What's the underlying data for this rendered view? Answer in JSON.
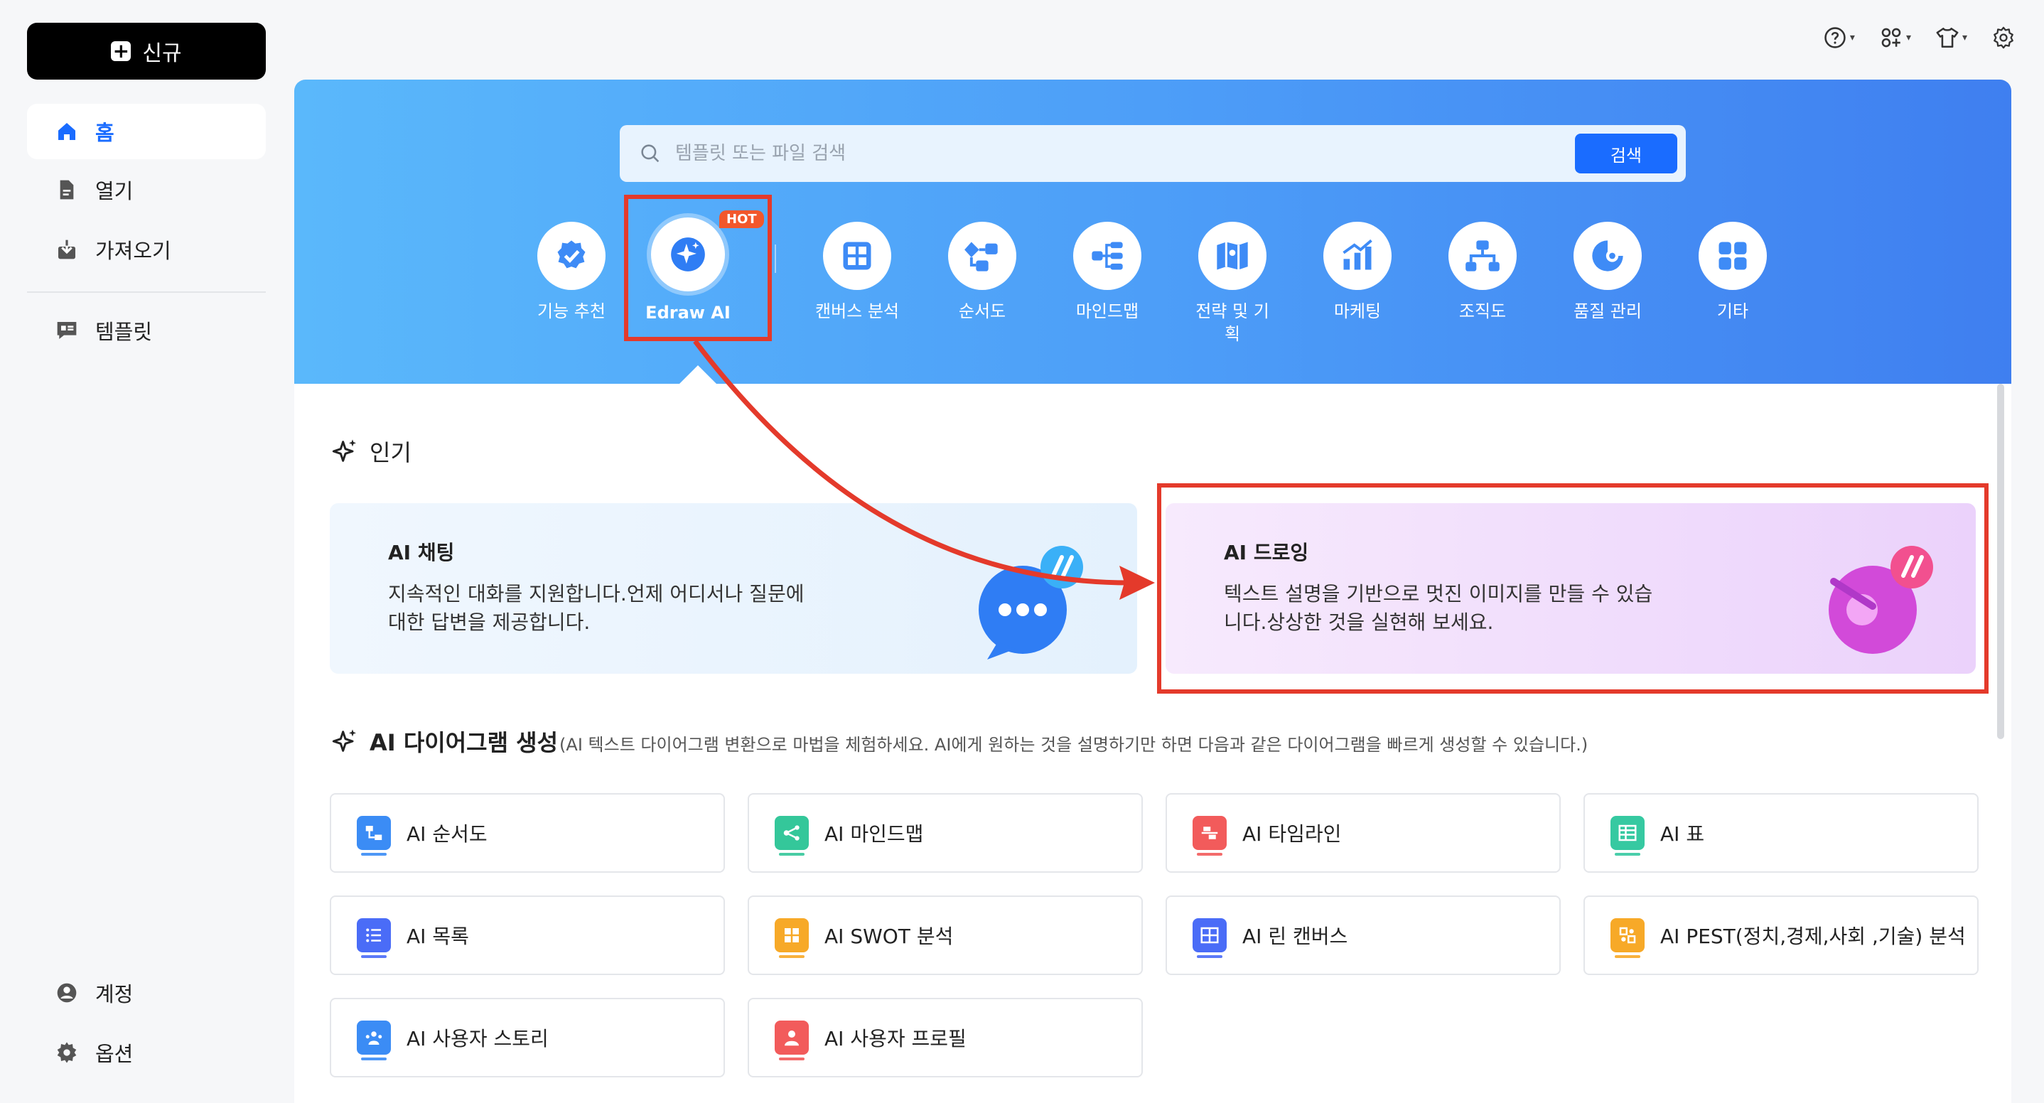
{
  "sidebar": {
    "new_button": "신규",
    "items": [
      {
        "label": "홈",
        "icon": "home-icon"
      },
      {
        "label": "열기",
        "icon": "file-icon"
      },
      {
        "label": "가져오기",
        "icon": "import-icon"
      },
      {
        "label": "템플릿",
        "icon": "template-icon"
      }
    ],
    "bottom": [
      {
        "label": "계정",
        "icon": "account-icon"
      },
      {
        "label": "옵션",
        "icon": "settings-icon"
      }
    ]
  },
  "top_icons": [
    "help-icon",
    "apps-icon",
    "shirt-icon",
    "gear-icon"
  ],
  "search": {
    "placeholder": "템플릿 또는 파일 검색",
    "button": "검색"
  },
  "categories": [
    {
      "label": "기능 추천",
      "icon": "badge-check-icon"
    },
    {
      "label": "Edraw AI",
      "icon": "ai-sparkle-icon",
      "badge": "HOT"
    },
    {
      "label": "캔버스 분석",
      "icon": "canvas-grid-icon"
    },
    {
      "label": "순서도",
      "icon": "flowchart-icon"
    },
    {
      "label": "마인드맵",
      "icon": "mindmap-icon"
    },
    {
      "label": "전략 및 기획",
      "icon": "map-icon"
    },
    {
      "label": "마케팅",
      "icon": "chart-bar-icon"
    },
    {
      "label": "조직도",
      "icon": "org-chart-icon"
    },
    {
      "label": "품질 관리",
      "icon": "quality-icon"
    },
    {
      "label": "기타",
      "icon": "more-grid-icon"
    }
  ],
  "popular": {
    "title": "인기",
    "cards": [
      {
        "title": "AI 채팅",
        "desc": "지속적인 대화를 지원합니다.언제 어디서나 질문에 대한 답변을 제공합니다."
      },
      {
        "title": "AI 드로잉",
        "desc": "텍스트 설명을 기반으로 멋진 이미지를 만들 수 있습니다.상상한 것을 실현해 보세요."
      }
    ]
  },
  "ai_diagram": {
    "title": "AI 다이어그램 생성",
    "subtitle": "(AI 텍스트 다이어그램 변환으로 마법을 체험하세요. AI에게 원하는 것을 설명하기만 하면 다음과 같은 다이어그램을 빠르게 생성할 수 있습니다.)",
    "items": [
      {
        "label": "AI 순서도",
        "color": "#3b8cf5"
      },
      {
        "label": "AI 마인드맵",
        "color": "#34c79a"
      },
      {
        "label": "AI 타임라인",
        "color": "#f25b5b"
      },
      {
        "label": "AI 표",
        "color": "#36c9a1"
      },
      {
        "label": "AI 목록",
        "color": "#4a6cf7"
      },
      {
        "label": "AI SWOT 분석",
        "color": "#f7a928"
      },
      {
        "label": "AI 린 캔버스",
        "color": "#4a6cf7"
      },
      {
        "label": "AI PEST(정치,경제,사회 ,기술) 분석",
        "color": "#f7a928"
      },
      {
        "label": "AI 사용자 스토리",
        "color": "#3b8cf5"
      },
      {
        "label": "AI 사용자 프로필",
        "color": "#f25b5b"
      }
    ]
  },
  "colors": {
    "accent": "#1a6cff",
    "annotation": "#e43a2b",
    "hero_start": "#5ab8fb",
    "hero_end": "#3f7ff0"
  }
}
